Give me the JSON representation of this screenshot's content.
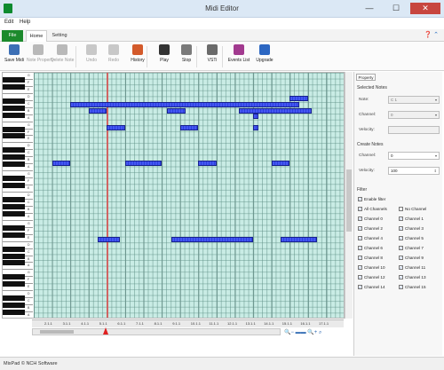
{
  "window": {
    "title": "Midi Editor",
    "min": "—",
    "max": "☐",
    "close": "✕"
  },
  "menu": {
    "edit": "Edit",
    "help": "Help"
  },
  "tabs": {
    "file": "File",
    "home": "Home",
    "setting": "Setting"
  },
  "toolbar": [
    {
      "label": "Save Midi",
      "color": "#3c6fb5",
      "disabled": false
    },
    {
      "label": "Note Property",
      "color": "#b9b9b9",
      "disabled": true
    },
    {
      "label": "Delete Note",
      "color": "#b9b9b9",
      "disabled": true
    },
    {
      "label": "Undo",
      "color": "#c8c8c8",
      "disabled": true
    },
    {
      "label": "Redo",
      "color": "#c8c8c8",
      "disabled": true
    },
    {
      "label": "History",
      "color": "#d35a2b",
      "disabled": false
    },
    {
      "label": "Play",
      "color": "#333333",
      "disabled": false
    },
    {
      "label": "Stop",
      "color": "#7a7a7a",
      "disabled": false
    },
    {
      "label": "VSTi",
      "color": "#6a6a6a",
      "disabled": false
    },
    {
      "label": "Events List",
      "color": "#a23a8f",
      "disabled": false
    },
    {
      "label": "Upgrade",
      "color": "#2b66c2",
      "disabled": false
    }
  ],
  "key_labels": [
    "G",
    "F",
    "E",
    "D",
    "C",
    "B",
    "A",
    "G",
    "F",
    "E",
    "D",
    "C",
    "B",
    "A",
    "G",
    "F",
    "E",
    "D",
    "C",
    "B",
    "A",
    "G",
    "F",
    "E",
    "D",
    "C",
    "B",
    "A",
    "G",
    "F",
    "E",
    "D",
    "C",
    "B",
    "A"
  ],
  "timeline": [
    "2.1.1",
    "3.1.1",
    "4.1.1",
    "5.1.1",
    "6.1.1",
    "7.1.1",
    "8.1.1",
    "9.1.1",
    "10.1.1",
    "11.1.1",
    "12.1.1",
    "13.1.1",
    "14.1.1",
    "15.1.1",
    "16.1.1",
    "17.1.1"
  ],
  "notes": [
    {
      "row": 5,
      "start": 2.0,
      "len": 12.5
    },
    {
      "row": 6,
      "start": 3.0,
      "len": 1.0
    },
    {
      "row": 6,
      "start": 7.3,
      "len": 1.0
    },
    {
      "row": 6,
      "start": 11.2,
      "len": 4.0
    },
    {
      "row": 7,
      "start": 12.0,
      "len": 0.3
    },
    {
      "row": 9,
      "start": 4.0,
      "len": 1.0
    },
    {
      "row": 9,
      "start": 8.0,
      "len": 1.0
    },
    {
      "row": 9,
      "start": 12.0,
      "len": 0.3
    },
    {
      "row": 15,
      "start": 1.0,
      "len": 1.0
    },
    {
      "row": 15,
      "start": 5.0,
      "len": 2.0
    },
    {
      "row": 15,
      "start": 9.0,
      "len": 1.0
    },
    {
      "row": 15,
      "start": 13.0,
      "len": 1.0
    },
    {
      "row": 4,
      "start": 14.0,
      "len": 1.0
    },
    {
      "row": 28,
      "start": 3.5,
      "len": 1.2
    },
    {
      "row": 28,
      "start": 7.5,
      "len": 4.5
    },
    {
      "row": 28,
      "start": 13.5,
      "len": 2.0
    }
  ],
  "panel": {
    "tab": "Property",
    "selected_notes": "Selected Notes",
    "note_label": "Note:",
    "note_value": "C 1",
    "channel_label": "Channel:",
    "channel_value": "0",
    "velocity_label": "Velocity:",
    "create_notes": "Create Notes",
    "create_channel_label": "Channel:",
    "create_channel_value": "0",
    "create_velocity_label": "Velocity:",
    "create_velocity_value": "100",
    "filter": "Filter",
    "enable_filter": "Enable filter",
    "all_channels": "All Channels",
    "no_channel": "No Channel",
    "channels_left": [
      "Channel 0",
      "Channel 2",
      "Channel 4",
      "Channel 6",
      "Channel 8",
      "Channel 10",
      "Channel 12",
      "Channel 14"
    ],
    "channels_right": [
      "Channel 1",
      "Channel 3",
      "Channel 5",
      "Channel 7",
      "Channel 9",
      "Channel 11",
      "Channel 13",
      "Channel 15"
    ]
  },
  "status": "MixPad © NCH Software"
}
